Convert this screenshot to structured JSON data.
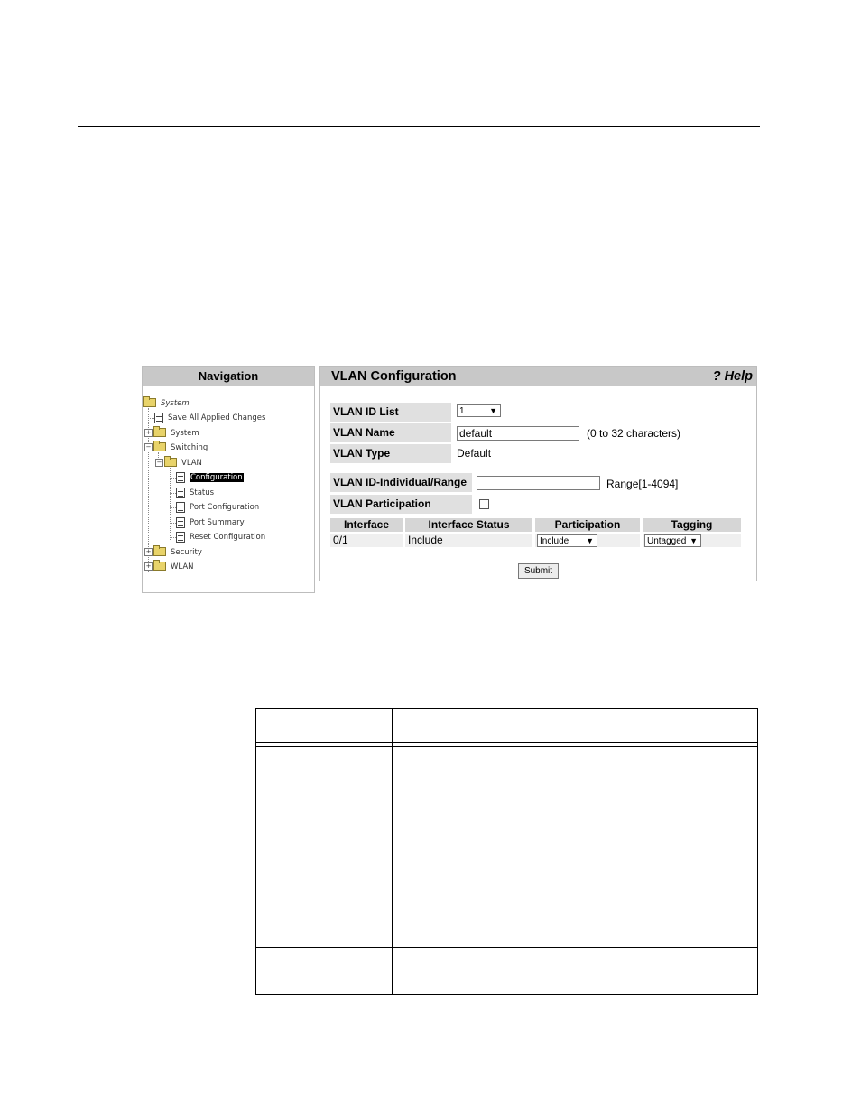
{
  "navigation": {
    "title": "Navigation",
    "tree": [
      {
        "label": "System",
        "type": "folder"
      },
      {
        "label": "Save All Applied Changes",
        "type": "page"
      },
      {
        "label": "System",
        "type": "folder"
      },
      {
        "label": "Switching",
        "type": "folder"
      },
      {
        "label": "VLAN",
        "type": "folder"
      },
      {
        "label": "Configuration",
        "type": "page",
        "selected": true
      },
      {
        "label": "Status",
        "type": "page"
      },
      {
        "label": "Port Configuration",
        "type": "page"
      },
      {
        "label": "Port Summary",
        "type": "page"
      },
      {
        "label": "Reset Configuration",
        "type": "page"
      },
      {
        "label": "Security",
        "type": "folder"
      },
      {
        "label": "WLAN",
        "type": "folder"
      }
    ]
  },
  "vlan_config": {
    "title": "VLAN Configuration",
    "help_label": "? Help",
    "vlan_id_list_label": "VLAN ID List",
    "vlan_id_list_value": "1",
    "vlan_name_label": "VLAN Name",
    "vlan_name_value": "default",
    "vlan_name_hint": "(0 to 32 characters)",
    "vlan_type_label": "VLAN Type",
    "vlan_type_value": "Default",
    "vlan_id_range_label": "VLAN ID-Individual/Range",
    "vlan_id_range_value": "",
    "vlan_id_range_hint": "Range[1-4094]",
    "vlan_participation_label": "VLAN Participation",
    "vlan_participation_checked": false,
    "table": {
      "headers": [
        "Interface",
        "Interface Status",
        "Participation",
        "Tagging"
      ],
      "rows": [
        {
          "interface": "0/1",
          "status": "Include",
          "participation": "Include",
          "tagging": "Untagged"
        }
      ]
    },
    "submit_label": "Submit"
  }
}
